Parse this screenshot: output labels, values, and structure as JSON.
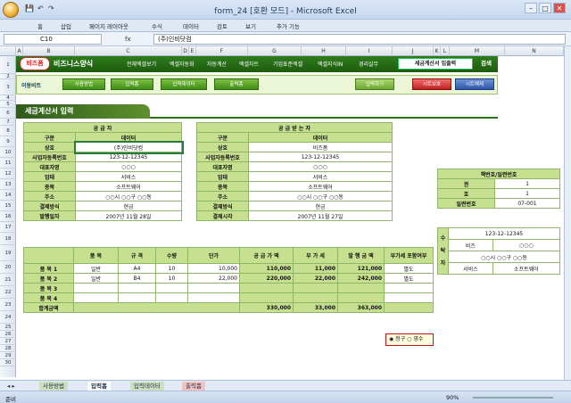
{
  "window": {
    "title": "form_24 [호환 모드] - Microsoft Excel",
    "min": "–",
    "max": "□",
    "close": "✕"
  },
  "menu": [
    "홈",
    "삽입",
    "페이지 레이아웃",
    "수식",
    "데이터",
    "검토",
    "보기",
    "추가 기능"
  ],
  "formula": {
    "cell": "C10",
    "fx": "fx",
    "value": "(주)인비닷컴"
  },
  "columns": [
    "A",
    "B",
    "C",
    "D",
    "E",
    "F",
    "G",
    "H",
    "I",
    "J",
    "K",
    "L",
    "M",
    "N",
    "O"
  ],
  "rows": [
    "1",
    "2",
    "3",
    "4",
    "5",
    "6",
    "7",
    "8",
    "9",
    "10",
    "11",
    "12",
    "13",
    "14",
    "15",
    "16",
    "17",
    "18",
    "19",
    "20",
    "21",
    "22",
    "23",
    "24",
    "25",
    "26",
    "27",
    "28",
    "29",
    "30"
  ],
  "banner": {
    "logo": "비즈폼",
    "logo2": "비즈니스양식",
    "nav": [
      "전체엑셀보기",
      "엑셀자동화",
      "자동계산",
      "엑셀차트",
      "기업표준엑셀",
      "엑셀지식IN",
      "경리실무"
    ],
    "selected": "세금계산서 입출력",
    "exit": "검색"
  },
  "bar2": {
    "label": "이동비트",
    "buttons": [
      "사용방법",
      "입력폼",
      "입력데이터",
      "출력폼"
    ],
    "input": "입력하기",
    "protect": "시트보호",
    "unprotect": "시트해제"
  },
  "section_title": "세금계산서 입력",
  "supplier": {
    "title": "공 급 자",
    "header": [
      "구분",
      "데이터"
    ],
    "rows": [
      [
        "상호",
        "(주)인비닷컴"
      ],
      [
        "사업자등록번호",
        "123-12-12345"
      ],
      [
        "대표자명",
        "○○○"
      ],
      [
        "업태",
        "서비스"
      ],
      [
        "종목",
        "소프트웨어"
      ],
      [
        "주소",
        "○○시 ○○구 ○○동"
      ],
      [
        "결제방식",
        "현금"
      ],
      [
        "발행일자",
        "2007년 11월 28일"
      ]
    ]
  },
  "receiver": {
    "title": "공 급 받 는 자",
    "header": [
      "구분",
      "데이터"
    ],
    "rows": [
      [
        "상호",
        "비즈폼"
      ],
      [
        "사업자등록번호",
        "123-12-12345"
      ],
      [
        "대표자명",
        "○○○"
      ],
      [
        "업태",
        "서비스"
      ],
      [
        "종목",
        "소프트웨어"
      ],
      [
        "주소",
        "○○시 ○○구 ○○동"
      ],
      [
        "결제방식",
        "현금"
      ],
      [
        "결제시각",
        "2007년 11월 27일"
      ]
    ]
  },
  "book": {
    "title": "책번호/일련번호",
    "rows": [
      [
        "권",
        "1"
      ],
      [
        "호",
        "1"
      ],
      [
        "일련번호",
        "07-001"
      ]
    ]
  },
  "consignee": {
    "side": [
      "수",
      "탁",
      "자"
    ],
    "rows": [
      [
        "123-12-12345"
      ],
      [
        "비즈",
        "○○○"
      ],
      [
        "○○시 ○○구 ○○동"
      ],
      [
        "서비스",
        "소프트웨어"
      ]
    ]
  },
  "items": {
    "headers": [
      "품 목",
      "규 격",
      "수량",
      "단가",
      "공 급 가 액",
      "부 가 세",
      "발 행 금 액",
      "부가세 포함여부"
    ],
    "rows": [
      [
        "품 목 1",
        "일반",
        "A4",
        "10",
        "10,000",
        "110,000",
        "11,000",
        "121,000",
        "별도"
      ],
      [
        "품 목 2",
        "일반",
        "B4",
        "10",
        "22,000",
        "220,000",
        "22,000",
        "242,000",
        "별도"
      ],
      [
        "품 목 3",
        "",
        "",
        "",
        "",
        "",
        "",
        "",
        ""
      ],
      [
        "품 목 4",
        "",
        "",
        "",
        "",
        "",
        "",
        "",
        ""
      ]
    ],
    "total": [
      "합계금액",
      "330,000",
      "33,000",
      "363,000"
    ]
  },
  "radios": {
    "a": "영수",
    "b": "청구"
  },
  "sheets": [
    "사용방법",
    "입력폼",
    "입력데이터",
    "출력폼"
  ],
  "status": {
    "ready": "준비",
    "zoom": "90%"
  }
}
